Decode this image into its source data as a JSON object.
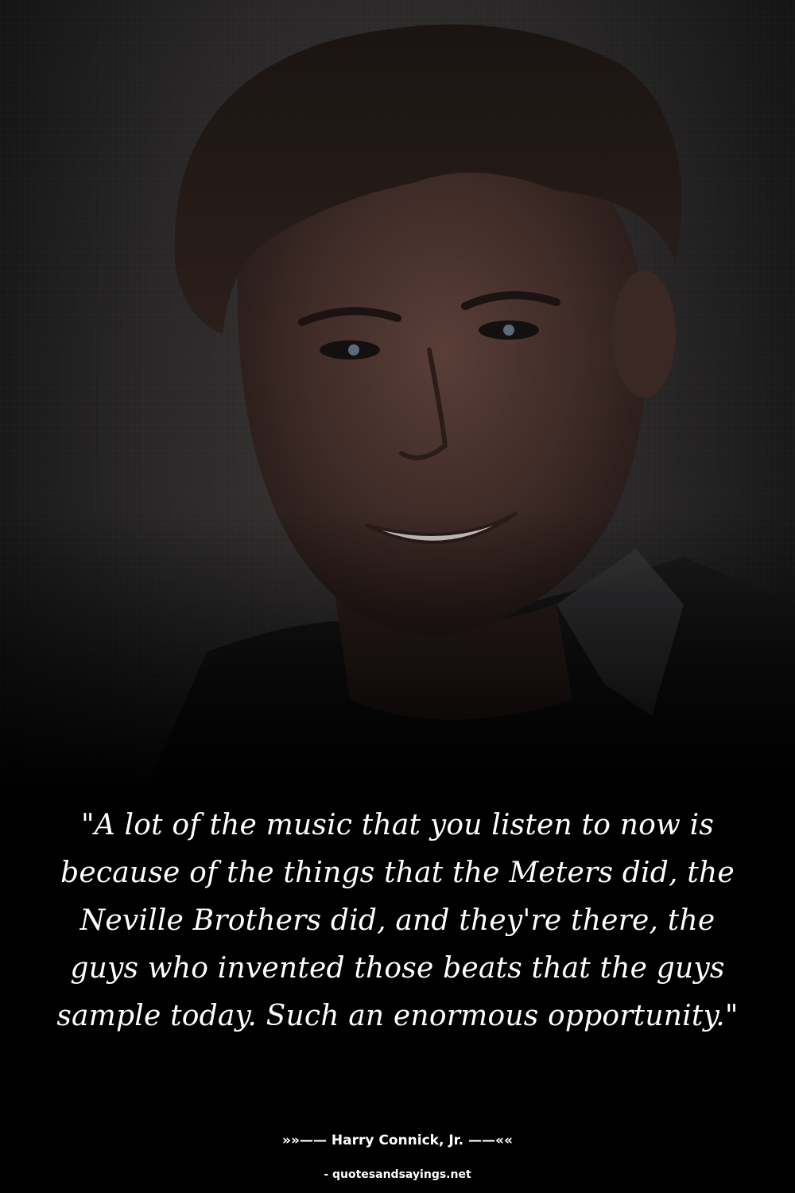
{
  "quote": {
    "text": "\"A lot of the music that you listen to now is because of the things that the Meters did, the Neville Brothers did, and they're there, the guys who invented those beats that the guys sample today. Such an enormous opportunity.\""
  },
  "author": {
    "line": "»»—— Harry Connick, Jr. ——««"
  },
  "source": {
    "line": "- quotesandsayings.net"
  },
  "colors": {
    "background": "#000000",
    "text": "#ffffff"
  },
  "image": {
    "subject": "portrait-photo"
  }
}
